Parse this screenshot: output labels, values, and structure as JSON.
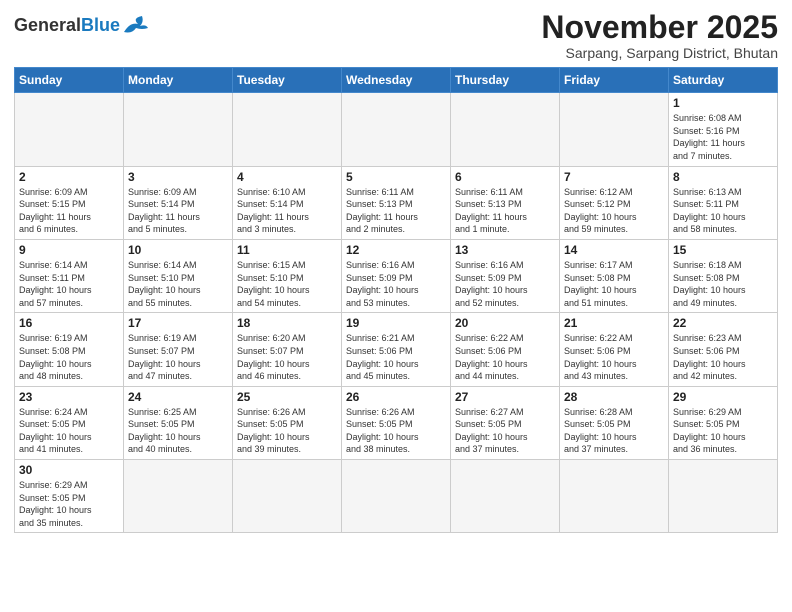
{
  "header": {
    "logo_general": "General",
    "logo_blue": "Blue",
    "month_title": "November 2025",
    "subtitle": "Sarpang, Sarpang District, Bhutan"
  },
  "weekdays": [
    "Sunday",
    "Monday",
    "Tuesday",
    "Wednesday",
    "Thursday",
    "Friday",
    "Saturday"
  ],
  "weeks": [
    [
      {
        "day": "",
        "info": ""
      },
      {
        "day": "",
        "info": ""
      },
      {
        "day": "",
        "info": ""
      },
      {
        "day": "",
        "info": ""
      },
      {
        "day": "",
        "info": ""
      },
      {
        "day": "",
        "info": ""
      },
      {
        "day": "1",
        "info": "Sunrise: 6:08 AM\nSunset: 5:16 PM\nDaylight: 11 hours\nand 7 minutes."
      }
    ],
    [
      {
        "day": "2",
        "info": "Sunrise: 6:09 AM\nSunset: 5:15 PM\nDaylight: 11 hours\nand 6 minutes."
      },
      {
        "day": "3",
        "info": "Sunrise: 6:09 AM\nSunset: 5:14 PM\nDaylight: 11 hours\nand 5 minutes."
      },
      {
        "day": "4",
        "info": "Sunrise: 6:10 AM\nSunset: 5:14 PM\nDaylight: 11 hours\nand 3 minutes."
      },
      {
        "day": "5",
        "info": "Sunrise: 6:11 AM\nSunset: 5:13 PM\nDaylight: 11 hours\nand 2 minutes."
      },
      {
        "day": "6",
        "info": "Sunrise: 6:11 AM\nSunset: 5:13 PM\nDaylight: 11 hours\nand 1 minute."
      },
      {
        "day": "7",
        "info": "Sunrise: 6:12 AM\nSunset: 5:12 PM\nDaylight: 10 hours\nand 59 minutes."
      },
      {
        "day": "8",
        "info": "Sunrise: 6:13 AM\nSunset: 5:11 PM\nDaylight: 10 hours\nand 58 minutes."
      }
    ],
    [
      {
        "day": "9",
        "info": "Sunrise: 6:14 AM\nSunset: 5:11 PM\nDaylight: 10 hours\nand 57 minutes."
      },
      {
        "day": "10",
        "info": "Sunrise: 6:14 AM\nSunset: 5:10 PM\nDaylight: 10 hours\nand 55 minutes."
      },
      {
        "day": "11",
        "info": "Sunrise: 6:15 AM\nSunset: 5:10 PM\nDaylight: 10 hours\nand 54 minutes."
      },
      {
        "day": "12",
        "info": "Sunrise: 6:16 AM\nSunset: 5:09 PM\nDaylight: 10 hours\nand 53 minutes."
      },
      {
        "day": "13",
        "info": "Sunrise: 6:16 AM\nSunset: 5:09 PM\nDaylight: 10 hours\nand 52 minutes."
      },
      {
        "day": "14",
        "info": "Sunrise: 6:17 AM\nSunset: 5:08 PM\nDaylight: 10 hours\nand 51 minutes."
      },
      {
        "day": "15",
        "info": "Sunrise: 6:18 AM\nSunset: 5:08 PM\nDaylight: 10 hours\nand 49 minutes."
      }
    ],
    [
      {
        "day": "16",
        "info": "Sunrise: 6:19 AM\nSunset: 5:08 PM\nDaylight: 10 hours\nand 48 minutes."
      },
      {
        "day": "17",
        "info": "Sunrise: 6:19 AM\nSunset: 5:07 PM\nDaylight: 10 hours\nand 47 minutes."
      },
      {
        "day": "18",
        "info": "Sunrise: 6:20 AM\nSunset: 5:07 PM\nDaylight: 10 hours\nand 46 minutes."
      },
      {
        "day": "19",
        "info": "Sunrise: 6:21 AM\nSunset: 5:06 PM\nDaylight: 10 hours\nand 45 minutes."
      },
      {
        "day": "20",
        "info": "Sunrise: 6:22 AM\nSunset: 5:06 PM\nDaylight: 10 hours\nand 44 minutes."
      },
      {
        "day": "21",
        "info": "Sunrise: 6:22 AM\nSunset: 5:06 PM\nDaylight: 10 hours\nand 43 minutes."
      },
      {
        "day": "22",
        "info": "Sunrise: 6:23 AM\nSunset: 5:06 PM\nDaylight: 10 hours\nand 42 minutes."
      }
    ],
    [
      {
        "day": "23",
        "info": "Sunrise: 6:24 AM\nSunset: 5:05 PM\nDaylight: 10 hours\nand 41 minutes."
      },
      {
        "day": "24",
        "info": "Sunrise: 6:25 AM\nSunset: 5:05 PM\nDaylight: 10 hours\nand 40 minutes."
      },
      {
        "day": "25",
        "info": "Sunrise: 6:26 AM\nSunset: 5:05 PM\nDaylight: 10 hours\nand 39 minutes."
      },
      {
        "day": "26",
        "info": "Sunrise: 6:26 AM\nSunset: 5:05 PM\nDaylight: 10 hours\nand 38 minutes."
      },
      {
        "day": "27",
        "info": "Sunrise: 6:27 AM\nSunset: 5:05 PM\nDaylight: 10 hours\nand 37 minutes."
      },
      {
        "day": "28",
        "info": "Sunrise: 6:28 AM\nSunset: 5:05 PM\nDaylight: 10 hours\nand 37 minutes."
      },
      {
        "day": "29",
        "info": "Sunrise: 6:29 AM\nSunset: 5:05 PM\nDaylight: 10 hours\nand 36 minutes."
      }
    ],
    [
      {
        "day": "30",
        "info": "Sunrise: 6:29 AM\nSunset: 5:05 PM\nDaylight: 10 hours\nand 35 minutes."
      },
      {
        "day": "",
        "info": ""
      },
      {
        "day": "",
        "info": ""
      },
      {
        "day": "",
        "info": ""
      },
      {
        "day": "",
        "info": ""
      },
      {
        "day": "",
        "info": ""
      },
      {
        "day": "",
        "info": ""
      }
    ]
  ]
}
